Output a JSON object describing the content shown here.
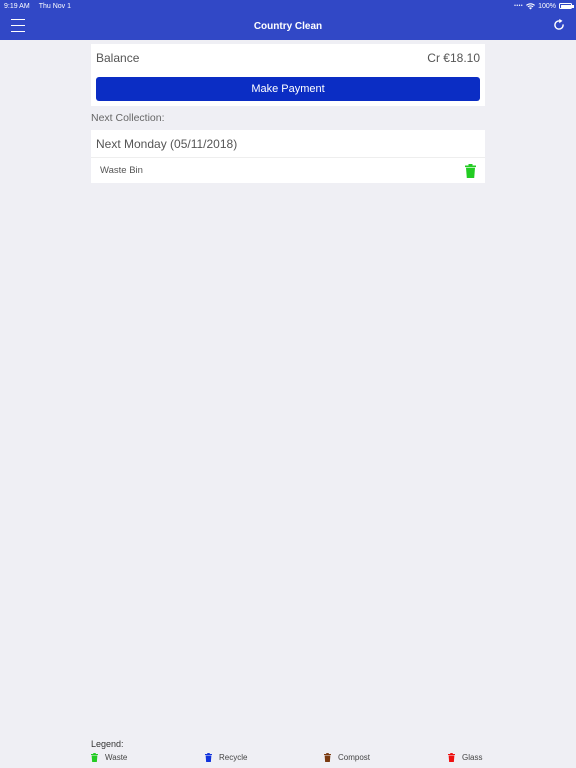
{
  "status_bar": {
    "time": "9:19 AM",
    "date": "Thu Nov 1",
    "battery": "100%"
  },
  "nav": {
    "title": "Country Clean",
    "menu_icon": "hamburger-icon",
    "refresh_icon": "refresh-icon"
  },
  "balance": {
    "label": "Balance",
    "value": "Cr €18.10",
    "pay_button": "Make Payment"
  },
  "next_collection": {
    "section_label": "Next Collection:",
    "date": "Next Monday (05/11/2018)",
    "items": [
      {
        "name": "Waste Bin",
        "icon": "trash-icon",
        "color": "#22cc22"
      }
    ]
  },
  "legend": {
    "label": "Legend:",
    "items": [
      {
        "name": "Waste",
        "color": "#22cc22"
      },
      {
        "name": "Recycle",
        "color": "#1133dd"
      },
      {
        "name": "Compost",
        "color": "#7a3a10"
      },
      {
        "name": "Glass",
        "color": "#ee1111"
      }
    ]
  },
  "colors": {
    "brand": "#3148c6",
    "button": "#0b2dc4",
    "background": "#efeff4"
  }
}
